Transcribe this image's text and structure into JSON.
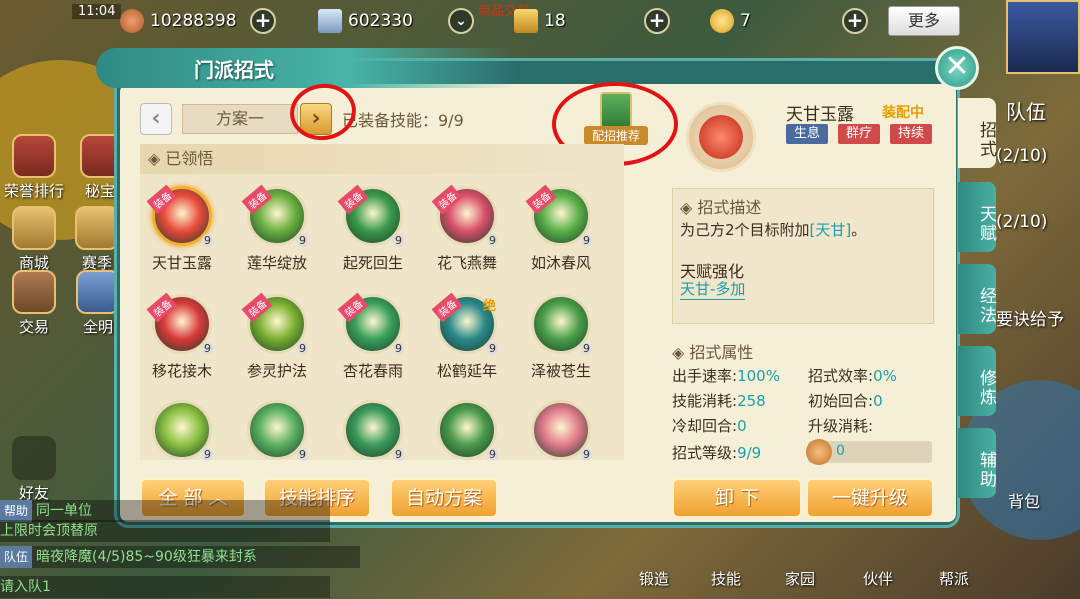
{
  "hud": {
    "time": "11:04",
    "copper": "10288398",
    "paper": "602330",
    "gold_ticket": "18",
    "ingot": "7",
    "more_label": "更多",
    "market_label": "商品交易"
  },
  "left_menu": [
    {
      "label": "荣誉排行"
    },
    {
      "label": "秘宝"
    },
    {
      "label": "商城"
    },
    {
      "label": "赛季"
    },
    {
      "label": "交易"
    },
    {
      "label": "全明"
    },
    {
      "label": "好友"
    }
  ],
  "panel": {
    "title": "门派招式",
    "scheme": "方案一",
    "equip_count": "已装备技能：9/9",
    "recommend_label": "配招推荐",
    "section_title": "已领悟",
    "skills": [
      {
        "name": "天甘玉露",
        "level": "9",
        "equipped": true,
        "tag": "装备",
        "color": "#e84a3a",
        "selected": true
      },
      {
        "name": "莲华绽放",
        "level": "9",
        "equipped": true,
        "tag": "装备",
        "color": "#6ab040"
      },
      {
        "name": "起死回生",
        "level": "9",
        "equipped": true,
        "tag": "装备",
        "color": "#3a9a4a"
      },
      {
        "name": "花飞燕舞",
        "level": "9",
        "equipped": true,
        "tag": "装备",
        "color": "#d8506a"
      },
      {
        "name": "如沐春风",
        "level": "9",
        "equipped": true,
        "tag": "装备",
        "color": "#5ab048"
      },
      {
        "name": "移花接木",
        "level": "9",
        "equipped": true,
        "tag": "装备",
        "color": "#d83a3a"
      },
      {
        "name": "参灵护法",
        "level": "9",
        "equipped": true,
        "tag": "装备",
        "color": "#7ab030"
      },
      {
        "name": "杏花春雨",
        "level": "9",
        "equipped": true,
        "tag": "装备",
        "color": "#3aa05a"
      },
      {
        "name": "松鹤延年",
        "level": "9",
        "equipped": true,
        "tag": "装备",
        "color": "#2a8a8a",
        "jue": "绝"
      },
      {
        "name": "泽被苍生",
        "level": "9",
        "equipped": false,
        "color": "#4aa048"
      },
      {
        "name": "",
        "level": "9",
        "equipped": false,
        "color": "#8ac040"
      },
      {
        "name": "",
        "level": "9",
        "equipped": false,
        "color": "#5ab060"
      },
      {
        "name": "",
        "level": "9",
        "equipped": false,
        "color": "#3a9a5a"
      },
      {
        "name": "",
        "level": "9",
        "equipped": false,
        "color": "#4a9a4a"
      },
      {
        "name": "",
        "level": "9",
        "equipped": false,
        "color": "#e07a8a"
      }
    ],
    "buttons": {
      "all": "全 部",
      "sort": "技能排序",
      "auto": "自动方案",
      "unload": "卸 下",
      "upgrade_all": "一键升级"
    }
  },
  "detail": {
    "name": "天甘玉露",
    "status": "装配中",
    "tags": [
      {
        "label": "生息",
        "color": "#4a6aa0"
      },
      {
        "label": "群疗",
        "color": "#d04a4a"
      },
      {
        "label": "持续",
        "color": "#d04a4a"
      }
    ],
    "desc_title": "招式描述",
    "desc_prefix": "为己方2个目标附加",
    "desc_link": "[天甘]",
    "desc_suffix": "。",
    "talent_title": "天赋强化",
    "talent_link": "天甘-多加",
    "attr_title": "招式属性",
    "stats": {
      "speed_label": "出手速率:",
      "speed": "100%",
      "eff_label": "招式效率:",
      "eff": "0%",
      "cost_label": "技能消耗:",
      "cost": "258",
      "init_label": "初始回合:",
      "init": "0",
      "cd_label": "冷却回合:",
      "cd": "0",
      "up_label": "升级消耗:",
      "level_label": "招式等级:",
      "level": "9/9",
      "upgrade_cost": "0"
    }
  },
  "side_tabs": [
    {
      "label": "招式",
      "active": true
    },
    {
      "label": "天赋"
    },
    {
      "label": "经法"
    },
    {
      "label": "修炼"
    },
    {
      "label": "辅助"
    }
  ],
  "behind_text": {
    "team": "队伍",
    "n1": "(2/10)",
    "n2": "(2/10)",
    "give": "要诀给予",
    "bag": "背包"
  },
  "chat": [
    {
      "tag": "帮助",
      "text": "同一单位"
    },
    {
      "tag": "",
      "text": "上限时会顶替原"
    },
    {
      "tag": "队伍",
      "text": "暗夜降魔(4/5)85~90级狂暴来封系"
    },
    {
      "tag": "",
      "text": "请入队1"
    }
  ],
  "bottom_menu": [
    {
      "label": "锻造"
    },
    {
      "label": "技能"
    },
    {
      "label": "家园"
    },
    {
      "label": "伙伴"
    },
    {
      "label": "帮派"
    }
  ],
  "colors": {
    "panel_teal": "#2a6e6a",
    "accent_orange": "#f0a030",
    "link_teal": "#1aa0a8",
    "annotation_red": "#e01414"
  }
}
